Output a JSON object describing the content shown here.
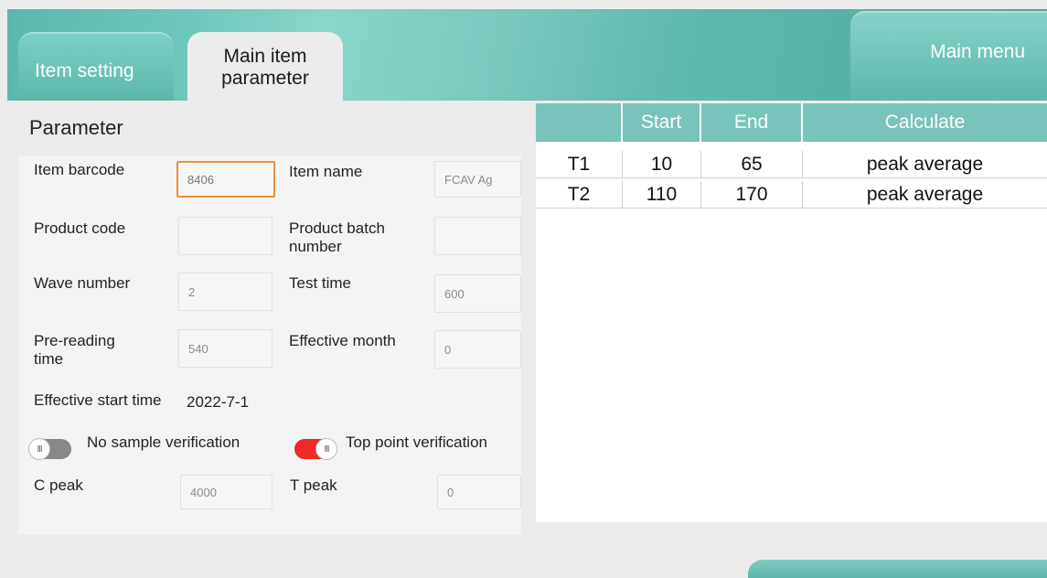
{
  "header": {
    "tab_item_setting": "Item setting",
    "tab_main_param_line1": "Main item",
    "tab_main_param_line2": "parameter",
    "main_menu": "Main menu"
  },
  "param": {
    "title": "Parameter",
    "item_barcode_label": "Item barcode",
    "item_barcode_value": "8406",
    "item_name_label": "Item name",
    "item_name_value": "FCAV Ag",
    "product_code_label": "Product code",
    "product_code_value": "",
    "product_batch_label_line1": "Product batch",
    "product_batch_label_line2": "number",
    "product_batch_value": "",
    "wave_number_label": "Wave number",
    "wave_number_value": "2",
    "test_time_label": "Test time",
    "test_time_value": "600",
    "pre_reading_label_line1": "Pre-reading",
    "pre_reading_label_line2": "time",
    "pre_reading_value": "540",
    "effective_month_label": "Effective month",
    "effective_month_value": "0",
    "effective_start_label": "Effective start time",
    "effective_start_value": "2022-7-1",
    "no_sample_label": "No sample verification",
    "no_sample_state": "off",
    "top_point_label": "Top point verification",
    "top_point_state": "on",
    "toggle_knob_glyph": "III",
    "c_peak_label": "C peak",
    "c_peak_value": "4000",
    "t_peak_label": "T peak",
    "t_peak_value": "0"
  },
  "table": {
    "headers": [
      "",
      "Start",
      "End",
      "Calculate"
    ],
    "rows": [
      [
        "T1",
        "10",
        "65",
        "peak average"
      ],
      [
        "T2",
        "110",
        "170",
        "peak average"
      ]
    ]
  },
  "colors": {
    "accent": "#5bb8ac",
    "table_header": "#79c4ba",
    "focus_border": "#e8923a",
    "toggle_on": "#ee2a26"
  }
}
